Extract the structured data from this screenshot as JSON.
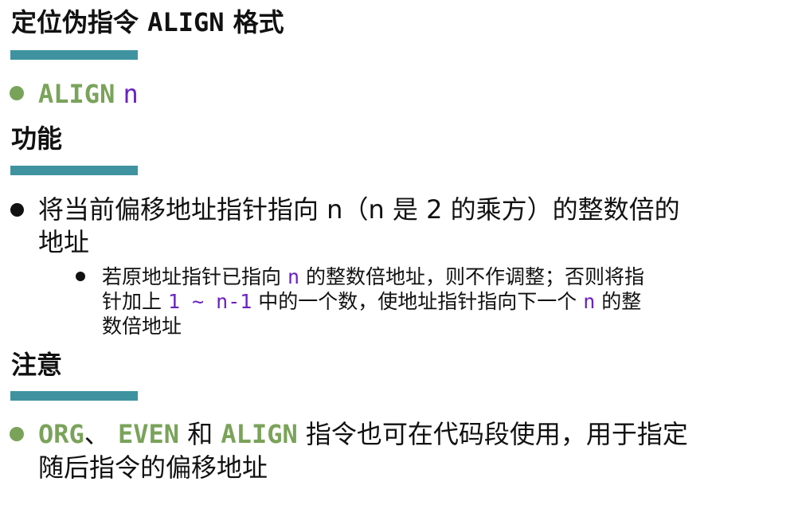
{
  "colors": {
    "accent_bar": "#3f93a0",
    "keyword_green": "#7aa35a",
    "operand_purple": "#6a22c0",
    "text": "#111111"
  },
  "section1": {
    "title_cn1": "定位伪指令 ",
    "title_code": "ALIGN",
    "title_cn2": " 格式",
    "bullet_kw": "ALIGN",
    "bullet_operand": "n"
  },
  "section2": {
    "title": "功能",
    "main_line1": "将当前偏移地址指针指向 n（n 是 2 的乘方）的整数倍的",
    "main_line2": "地址",
    "sub_l1_a": "若原地址指针已指向 ",
    "sub_l1_n": "n",
    "sub_l1_b": " 的整数倍地址，则不作调整；否则将指",
    "sub_l2_a": "针加上 ",
    "sub_l2_range": "1 ~ n-1",
    "sub_l2_b": " 中的一个数，使地址指针指向下一个 ",
    "sub_l2_n": "n",
    "sub_l2_c": " 的整",
    "sub_l3": "数倍地址"
  },
  "section3": {
    "title": "注意",
    "kw_org": "ORG",
    "sep1": "、 ",
    "kw_even": "EVEN",
    "and_text": " 和 ",
    "kw_align": "ALIGN",
    "line1_rest": " 指令也可在代码段使用，用于指定",
    "line2": "随后指令的偏移地址"
  }
}
